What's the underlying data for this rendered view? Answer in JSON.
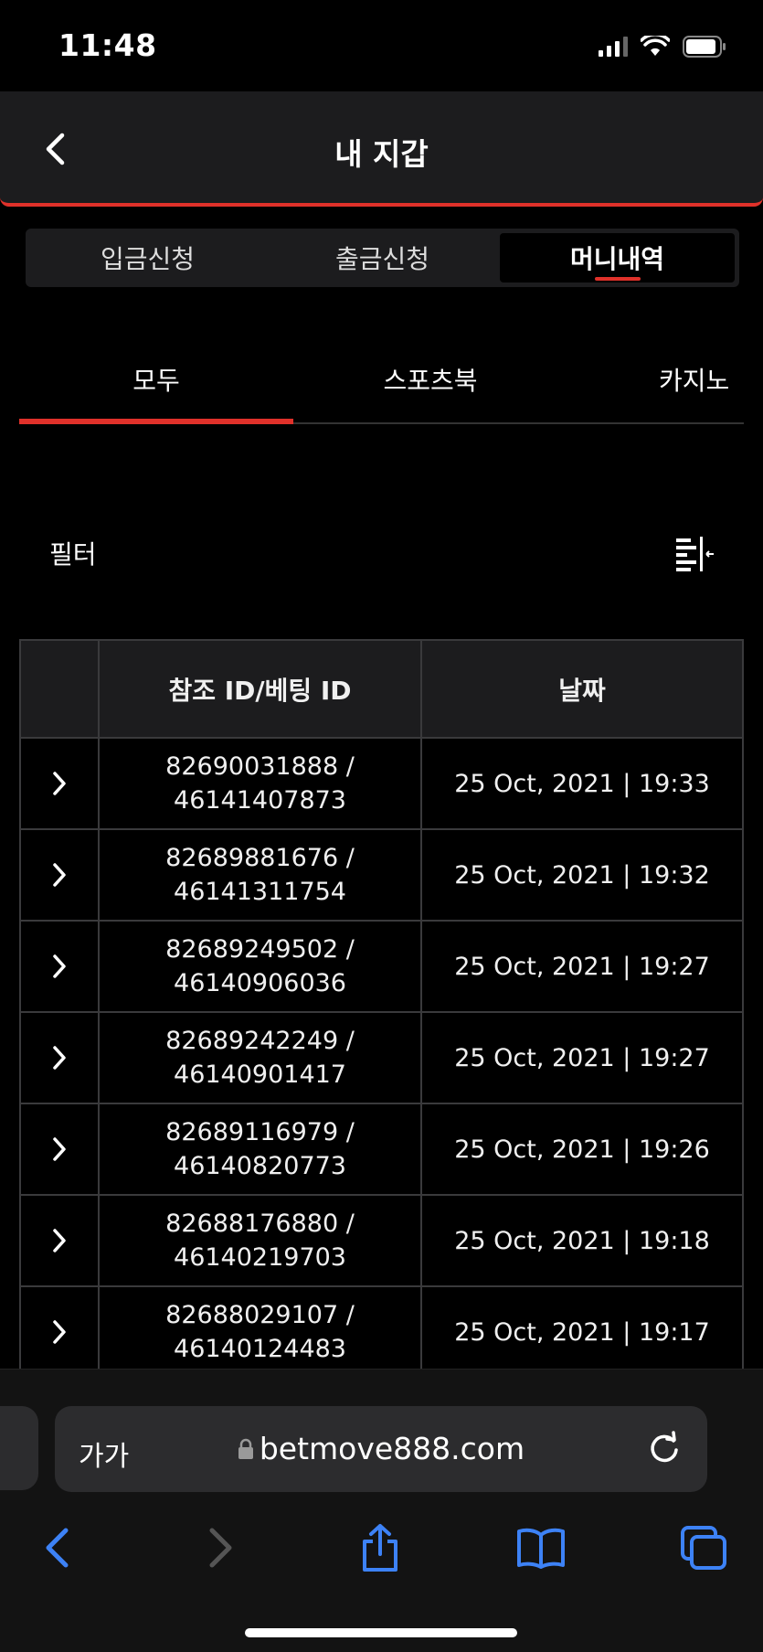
{
  "status_bar": {
    "time": "11:48"
  },
  "header": {
    "title": "내 지갑"
  },
  "segments": [
    {
      "label": "입금신청",
      "active": false
    },
    {
      "label": "출금신청",
      "active": false
    },
    {
      "label": "머니내역",
      "active": true
    }
  ],
  "category_tabs": [
    {
      "label": "모두",
      "active": true
    },
    {
      "label": "스포츠북",
      "active": false
    },
    {
      "label": "카지노",
      "active": false
    }
  ],
  "filter": {
    "label": "필터",
    "icon": "filter-list-icon"
  },
  "table": {
    "headers": [
      "",
      "참조 ID/베팅 ID",
      "날짜"
    ],
    "rows": [
      {
        "ref_id": "82690031888 /",
        "bet_id": "46141407873",
        "date": "25 Oct, 2021 | 19:33"
      },
      {
        "ref_id": "82689881676 /",
        "bet_id": "46141311754",
        "date": "25 Oct, 2021 | 19:32"
      },
      {
        "ref_id": "82689249502 /",
        "bet_id": "46140906036",
        "date": "25 Oct, 2021 | 19:27"
      },
      {
        "ref_id": "82689242249 /",
        "bet_id": "46140901417",
        "date": "25 Oct, 2021 | 19:27"
      },
      {
        "ref_id": "82689116979 /",
        "bet_id": "46140820773",
        "date": "25 Oct, 2021 | 19:26"
      },
      {
        "ref_id": "82688176880 /",
        "bet_id": "46140219703",
        "date": "25 Oct, 2021 | 19:18"
      },
      {
        "ref_id": "82688029107 /",
        "bet_id": "46140124483",
        "date": "25 Oct, 2021 | 19:17"
      }
    ]
  },
  "browser": {
    "text_size_label": "가가",
    "url": "betmove888.com"
  },
  "colors": {
    "accent": "#e0312a",
    "ios_blue": "#3d82f6",
    "background": "#000000"
  }
}
